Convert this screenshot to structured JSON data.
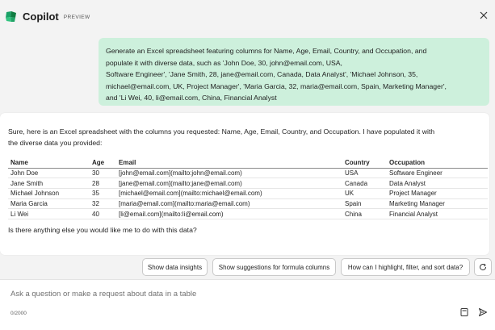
{
  "header": {
    "title": "Copilot",
    "badge": "PREVIEW",
    "logo_icon": "copilot-logo",
    "close_icon": "close-icon"
  },
  "user_message": {
    "lines": [
      "Generate an Excel spreadsheet featuring columns for Name, Age, Email, Country, and Occupation, and",
      "populate it with diverse data, such as 'John Doe, 30, john@email.com, USA,",
      "Software Engineer', 'Jane Smith, 28, jane@email.com, Canada, Data Analyst', 'Michael Johnson, 35,",
      "michael@email.com, UK, Project Manager', 'Maria Garcia, 32, maria@email.com, Spain, Marketing Manager',",
      "and 'Li Wei, 40, li@email.com, China, Financial Analyst"
    ]
  },
  "assistant": {
    "intro_line1": "Sure, here is an Excel spreadsheet with the columns you requested: Name, Age, Email, Country, and Occupation. I have populated it with",
    "intro_line2": "the diverse data you provided:",
    "table": {
      "headers": [
        "Name",
        "Age",
        "Email",
        "Country",
        "Occupation"
      ],
      "rows": [
        [
          "John Doe",
          "30",
          "[john@email.com](mailto:john@email.com)",
          "USA",
          "Software Engineer"
        ],
        [
          "Jane Smith",
          "28",
          "[jane@email.com](mailto:jane@email.com)",
          "Canada",
          "Data Analyst"
        ],
        [
          "Michael Johnson",
          "35",
          "[michael@email.com](mailto:michael@email.com)",
          "UK",
          "Project Manager"
        ],
        [
          "Maria Garcia",
          "32",
          "[maria@email.com](mailto:maria@email.com)",
          "Spain",
          "Marketing Manager"
        ],
        [
          "Li Wei",
          "40",
          "[li@email.com](mailto:li@email.com)",
          "China",
          "Financial Analyst"
        ]
      ]
    },
    "outro": "Is there anything else you would like me to do with this data?"
  },
  "suggestions": {
    "chips": [
      "Show data insights",
      "Show suggestions for formula columns",
      "How can I highlight, filter, and sort data?"
    ],
    "refresh_icon": "refresh-icon"
  },
  "composer": {
    "placeholder": "Ask a question or make a request about data in a table",
    "char_count": "0/2000",
    "notebook_icon": "notebook-icon",
    "send_icon": "send-icon"
  },
  "colors": {
    "user_bubble": "#cdf0dc",
    "background": "#f3f3f3",
    "card": "#ffffff"
  }
}
